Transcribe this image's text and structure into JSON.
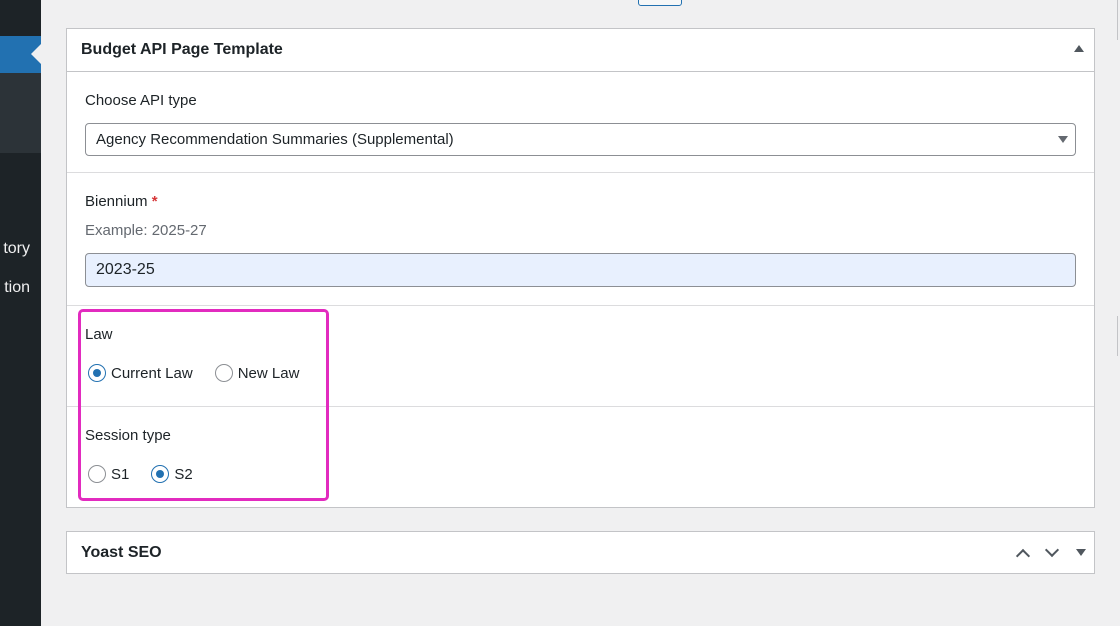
{
  "sidebar": {
    "items": [
      {
        "label": "tory"
      },
      {
        "label": "tion"
      }
    ]
  },
  "metabox": {
    "title": "Budget API Page Template",
    "api_type": {
      "label": "Choose API type",
      "selected": "Agency Recommendation Summaries (Supplemental)"
    },
    "biennium": {
      "label": "Biennium",
      "required_mark": "*",
      "hint": "Example: 2025-27",
      "value": "2023-25"
    },
    "law": {
      "label": "Law",
      "options": [
        {
          "label": "Current Law",
          "checked": true
        },
        {
          "label": "New Law",
          "checked": false
        }
      ]
    },
    "session_type": {
      "label": "Session type",
      "options": [
        {
          "label": "S1",
          "checked": false
        },
        {
          "label": "S2",
          "checked": true
        }
      ]
    }
  },
  "yoast": {
    "title": "Yoast SEO"
  },
  "colors": {
    "accent": "#2271b1",
    "highlight": "#e22bbf",
    "sidebar_bg": "#1d2327"
  }
}
